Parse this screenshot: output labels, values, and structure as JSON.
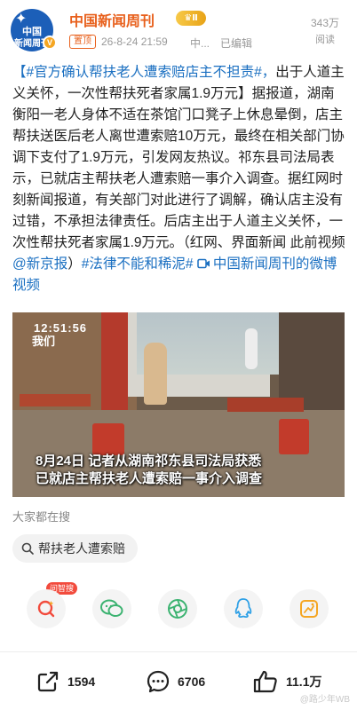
{
  "header": {
    "avatar_line1": "中国",
    "avatar_line2": "新闻周刊",
    "account_name": "中国新闻周刊",
    "vip_level": "Ⅱ",
    "pin_label": "置顶",
    "time": "26-8-24 21:59",
    "source": "中...",
    "edited": "已编辑",
    "read_count": "343万",
    "read_label": "阅读"
  },
  "post": {
    "headline_topic": "【#官方确认帮扶老人遭索赔店主不担责#，",
    "headline_rest": "出于人道主义关怀，一次性帮扶死者家属1.9万元】",
    "body": "据报道，湖南衡阳一老人身体不适在茶馆门口凳子上休息晕倒，店主帮扶送医后老人离世遭索赔10万元，最终在相关部门协调下支付了1.9万元，引发网友热议。祁东县司法局表示，已就店主帮扶老人遭索赔一事介入调查。据红网时刻新闻报道，有关部门对此进行了调解，确认店主没有过错，不承担法律责任。后店主出于人道主义关怀，一次性帮扶死者家属1.9万元。（红网、界面新闻 此前视频",
    "mention": "@新京报",
    "after_mention": "）",
    "topic2": "#法律不能和稀泥#",
    "video_link": "中国新闻周刊的微博视频"
  },
  "video": {
    "timestamp": "12:51:56",
    "logo": "我们",
    "caption_line1": "8月24日 记者从湖南祁东县司法局获悉",
    "caption_line2": "已就店主帮扶老人遭索赔一事介入调查"
  },
  "searches": {
    "title": "大家都在搜",
    "chip": "帮扶老人遭索赔"
  },
  "share": {
    "hot_badge": "问智搜",
    "items": [
      "ai-search-icon",
      "wechat-icon",
      "moments-icon",
      "qq-icon",
      "qzone-icon"
    ]
  },
  "actions": {
    "reposts": "1594",
    "comments": "6706",
    "likes": "11.1万"
  },
  "watermark": "@路少年WB",
  "colors": {
    "accent_orange": "#e8601c",
    "link_blue": "#1a6fc1",
    "hot_red": "#f24b3d"
  }
}
